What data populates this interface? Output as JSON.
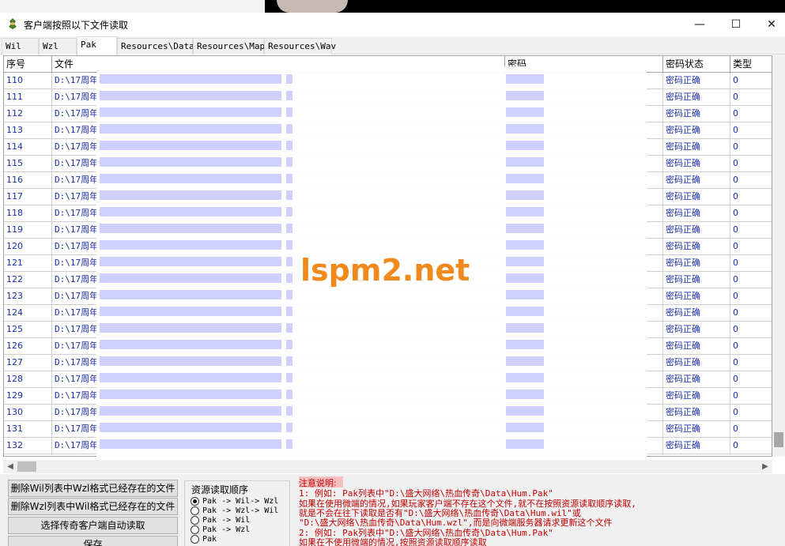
{
  "window": {
    "title": "客户端按照以下文件读取",
    "min_glyph": "—",
    "max_glyph": "☐",
    "close_glyph": "✕"
  },
  "tabs": [
    {
      "label": "Wil",
      "active": false
    },
    {
      "label": "Wzl",
      "active": false
    },
    {
      "label": "Pak",
      "active": true
    },
    {
      "label": "Resources\\Data",
      "active": false
    },
    {
      "label": "Resources\\Map",
      "active": false
    },
    {
      "label": "Resources\\Wav",
      "active": false
    }
  ],
  "table": {
    "columns": [
      "序号",
      "文件",
      "密码",
      "密码状态",
      "类型"
    ],
    "rows": [
      {
        "no": "110",
        "file": "D:\\17周年\\",
        "status": "密码正确",
        "type": "0"
      },
      {
        "no": "111",
        "file": "D:\\17周年\\",
        "status": "密码正确",
        "type": "0"
      },
      {
        "no": "112",
        "file": "D:\\17周年\\",
        "status": "密码正确",
        "type": "0"
      },
      {
        "no": "113",
        "file": "D:\\17周年\\",
        "status": "密码正确",
        "type": "0"
      },
      {
        "no": "114",
        "file": "D:\\17周年\\",
        "status": "密码正确",
        "type": "0"
      },
      {
        "no": "115",
        "file": "D:\\17周年\\",
        "status": "密码正确",
        "type": "0"
      },
      {
        "no": "116",
        "file": "D:\\17周年\\",
        "status": "密码正确",
        "type": "0"
      },
      {
        "no": "117",
        "file": "D:\\17周年\\",
        "status": "密码正确",
        "type": "0"
      },
      {
        "no": "118",
        "file": "D:\\17周年\\",
        "status": "密码正确",
        "type": "0"
      },
      {
        "no": "119",
        "file": "D:\\17周年\\",
        "status": "密码正确",
        "type": "0"
      },
      {
        "no": "120",
        "file": "D:\\17周年\\",
        "status": "密码正确",
        "type": "0"
      },
      {
        "no": "121",
        "file": "D:\\17周年\\",
        "status": "密码正确",
        "type": "0"
      },
      {
        "no": "122",
        "file": "D:\\17周年\\",
        "status": "密码正确",
        "type": "0"
      },
      {
        "no": "123",
        "file": "D:\\17周年\\",
        "status": "密码正确",
        "type": "0"
      },
      {
        "no": "124",
        "file": "D:\\17周年\\",
        "status": "密码正确",
        "type": "0"
      },
      {
        "no": "125",
        "file": "D:\\17周年\\",
        "status": "密码正确",
        "type": "0"
      },
      {
        "no": "126",
        "file": "D:\\17周年\\",
        "status": "密码正确",
        "type": "0"
      },
      {
        "no": "127",
        "file": "D:\\17周年\\",
        "status": "密码正确",
        "type": "0"
      },
      {
        "no": "128",
        "file": "D:\\17周年\\",
        "status": "密码正确",
        "type": "0"
      },
      {
        "no": "129",
        "file": "D:\\17周年\\",
        "status": "密码正确",
        "type": "0"
      },
      {
        "no": "130",
        "file": "D:\\17周年\\",
        "status": "密码正确",
        "type": "0"
      },
      {
        "no": "131",
        "file": "D:\\17周年\\",
        "status": "密码正确",
        "type": "0"
      },
      {
        "no": "132",
        "file": "D:\\17周年\\",
        "status": "密码正确",
        "type": "0"
      }
    ]
  },
  "watermark": "lspm2.net",
  "buttons": {
    "delete_wil": "删除Wil列表中Wzl格式已经存在的文件",
    "delete_wzl": "删除Wzl列表中Wil格式已经存在的文件",
    "select_client": "选择传奇客户端自动读取",
    "save": "保存"
  },
  "read_order": {
    "title": "资源读取顺序",
    "options": [
      {
        "label": "Pak -> Wil-> Wzl",
        "checked": true
      },
      {
        "label": "Pak -> Wzl-> Wil",
        "checked": false
      },
      {
        "label": "Pak -> Wil",
        "checked": false
      },
      {
        "label": "Pak -> Wzl",
        "checked": false
      },
      {
        "label": "Pak",
        "checked": false
      }
    ]
  },
  "notes": {
    "title": "注意说明:",
    "lines": [
      "1: 例如: Pak列表中\"D:\\盛大网络\\热血传奇\\Data\\Hum.Pak\"",
      "   如果在使用微端的情况,如果玩家客户端不存在这个文件,就不在按照资源读取顺序读取,",
      "   就是不会在往下读取是否有\"D:\\盛大网络\\热血传奇\\Data\\Hum.wil\"或",
      "   \"D:\\盛大网络\\热血传奇\\Data\\Hum.wzl\",而是向微端服务器请求更新这个文件",
      "2: 例如: Pak列表中\"D:\\盛大网络\\热血传奇\\Data\\Hum.Pak\"",
      "   如果在不使用微端的情况,按照资源读取顺序读取"
    ]
  },
  "colors": {
    "row_text": "#1a2ea8",
    "note_text": "#c00000",
    "watermark": "#f08a1c",
    "blur_bar": "#c8c7ff"
  }
}
